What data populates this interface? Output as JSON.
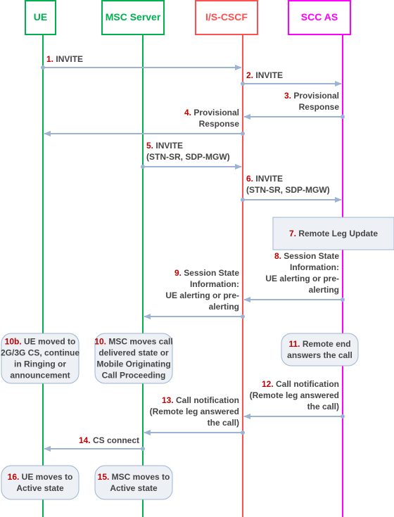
{
  "colors": {
    "ue": "#00b050",
    "msc": "#00b050",
    "cscf": "#ff5050",
    "scc": "#ff00ff",
    "arrow": "#9db3d3",
    "number": "#c00000",
    "box_fill": "#edf0f5",
    "box_stroke": "#9db3d3"
  },
  "entities": [
    {
      "id": "ue",
      "label": "UE"
    },
    {
      "id": "msc",
      "label": "MSC Server"
    },
    {
      "id": "cscf",
      "label": "I/S-CSCF"
    },
    {
      "id": "scc",
      "label": "SCC AS"
    }
  ],
  "messages": [
    {
      "num": "1.",
      "lines": [
        "INVITE"
      ],
      "from": "ue",
      "to": "cscf"
    },
    {
      "num": "2.",
      "lines": [
        "INVITE"
      ],
      "from": "cscf",
      "to": "scc"
    },
    {
      "num": "3.",
      "lines": [
        "Provisional",
        "Response"
      ],
      "from": "scc",
      "to": "cscf"
    },
    {
      "num": "4.",
      "lines": [
        "Provisional",
        "Response"
      ],
      "from": "cscf",
      "to": "ue"
    },
    {
      "num": "5.",
      "lines": [
        "INVITE",
        "(STN-SR, SDP-MGW)"
      ],
      "from": "msc",
      "to": "cscf"
    },
    {
      "num": "6.",
      "lines": [
        "INVITE",
        "(STN-SR, SDP-MGW)"
      ],
      "from": "cscf",
      "to": "scc"
    },
    {
      "num": "8.",
      "lines": [
        "Session State",
        "Information:",
        "UE alerting or pre-",
        "alerting"
      ],
      "from": "scc",
      "to": "cscf"
    },
    {
      "num": "9.",
      "lines": [
        "Session State",
        "Information:",
        "UE alerting or pre-",
        "alerting"
      ],
      "from": "cscf",
      "to": "msc"
    },
    {
      "num": "12.",
      "lines": [
        "Call notification",
        "(Remote leg answered",
        "the call)"
      ],
      "from": "scc",
      "to": "cscf"
    },
    {
      "num": "13.",
      "lines": [
        "Call notification",
        "(Remote leg answered",
        "the call)"
      ],
      "from": "cscf",
      "to": "msc"
    },
    {
      "num": "14.",
      "lines": [
        "CS connect"
      ],
      "from": "msc",
      "to": "ue"
    }
  ],
  "boxes": [
    {
      "num": "7.",
      "lines": [
        "Remote Leg Update"
      ],
      "shape": "rect"
    },
    {
      "num": "10b.",
      "lines": [
        "UE moved to",
        "2G/3G CS, continue",
        "in Ringing or",
        "announcement"
      ],
      "shape": "rounded"
    },
    {
      "num": "10.",
      "lines": [
        "MSC moves call",
        "delivered state or",
        "Mobile Originating",
        "Call Proceeding"
      ],
      "shape": "rounded"
    },
    {
      "num": "11.",
      "lines": [
        "Remote end",
        "answers the call"
      ],
      "shape": "rounded"
    },
    {
      "num": "16.",
      "lines": [
        "UE moves to",
        "Active state"
      ],
      "shape": "rounded"
    },
    {
      "num": "15.",
      "lines": [
        "MSC moves to",
        "Active state"
      ],
      "shape": "rounded"
    }
  ]
}
